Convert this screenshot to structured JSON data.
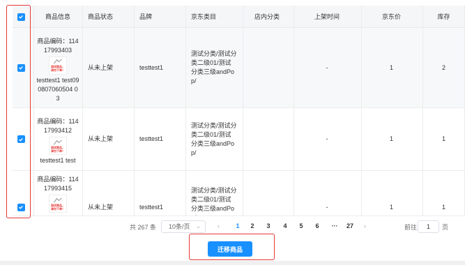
{
  "table": {
    "headers": {
      "info": "商品信息",
      "status": "商品状态",
      "brand": "品牌",
      "category": "京东类目",
      "shop_category": "店内分类",
      "shelf_time": "上架时间",
      "price": "京东价",
      "stock": "库存"
    },
    "rows": [
      {
        "code": "商品编码：11417993403",
        "thumb_line1": "测试商品，",
        "thumb_line2": "请勿下单！",
        "name": "testtest1 test090807060504 03",
        "status": "从未上架",
        "brand": "testtest1",
        "category": "测试分类/测试分类二级01/测试分类三级andPop/",
        "shop_category": "",
        "shelf_time": "-",
        "price": "1",
        "stock": "2"
      },
      {
        "code": "商品编码：11417993412",
        "thumb_line1": "测试商品，",
        "thumb_line2": "请勿下单！",
        "name": "testtest1 test",
        "status": "从未上架",
        "brand": "testtest1",
        "category": "测试分类/测试分类二级01/测试分类三级andPop/",
        "shop_category": "",
        "shelf_time": "-",
        "price": "1",
        "stock": "1"
      },
      {
        "code": "商品编码：11417993415",
        "thumb_line1": "测试商品，",
        "thumb_line2": "请勿下单！",
        "name": "",
        "status": "从未上架",
        "brand": "testtest1",
        "category": "测试分类/测试分类二级01/测试分类三级andPop/",
        "shop_category": "",
        "shelf_time": "-",
        "price": "1",
        "stock": "1"
      }
    ]
  },
  "pagination": {
    "total_text": "共 267 条",
    "page_size": "10条/页",
    "prev": "‹",
    "next": "›",
    "pages": [
      "1",
      "2",
      "3",
      "4",
      "5",
      "6",
      "···",
      "27"
    ],
    "current_page": "1",
    "goto_label": "前往",
    "goto_value": "1",
    "goto_unit": "页"
  },
  "actions": {
    "migrate_label": "迁移商品"
  },
  "colors": {
    "primary": "#1890ff",
    "highlight": "#e53935"
  }
}
